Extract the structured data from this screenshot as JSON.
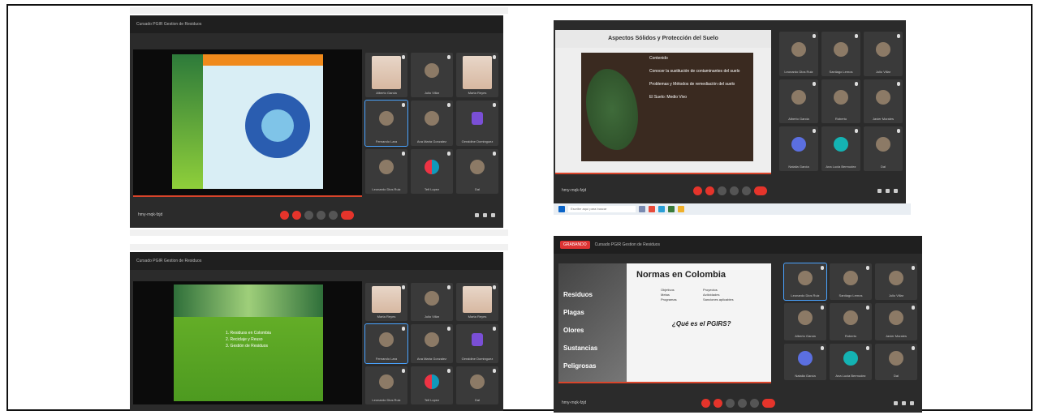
{
  "panels": {
    "tl": {
      "title": "Cursado PGIR Gestion de Residuos",
      "meeting_code": "hmy-rnqk-fzjd",
      "tiles": [
        {
          "name": "Alberto Garcia",
          "kind": "photo"
        },
        {
          "name": "Julio Villar",
          "kind": "avatar"
        },
        {
          "name": "Marta Reyes",
          "kind": "face"
        },
        {
          "name": "Fernando Lara",
          "kind": "avatar",
          "selected": true
        },
        {
          "name": "Ana Maria Gonzalez",
          "kind": "avatar"
        },
        {
          "name": "Geraldine Dominguez",
          "kind": "purple"
        },
        {
          "name": "Leonardo Dios Ruiz",
          "kind": "avatar"
        },
        {
          "name": "Tefi Lopez",
          "kind": "duo"
        },
        {
          "name": "Dal",
          "kind": "avatar"
        }
      ]
    },
    "tr": {
      "slide_title": "Aspectos Sólidos y Protección del Suelo",
      "slide_sub": "Contenido",
      "bullets": [
        "Conocer la sustitución de contaminantes del suelo",
        "Problemas y Métodos de remediación del suelo",
        "El Suelo: Medio Vivo"
      ],
      "meeting_code": "hmy-rnqk-fzjd",
      "taskbar_search": "Escribe aquí para buscar",
      "tiles": [
        {
          "name": "Leonardo Dios Ruiz",
          "kind": "avatar"
        },
        {
          "name": "Santiago Lemos",
          "kind": "avatar"
        },
        {
          "name": "Julio Villar",
          "kind": "avatar"
        },
        {
          "name": "Alberto Garcia",
          "kind": "avatar"
        },
        {
          "name": "Roberto",
          "kind": "avatar"
        },
        {
          "name": "Javier Morales",
          "kind": "avatar"
        },
        {
          "name": "Natalia Garcia",
          "kind": "blue"
        },
        {
          "name": "Ana Lucia Bermudez",
          "kind": "teal"
        },
        {
          "name": "Dal",
          "kind": "avatar"
        }
      ]
    },
    "bl": {
      "title": "Cursado PGIR Gestion de Residuos",
      "slide_items": [
        "1. Residuos en Colombia",
        "2. Reciclaje y Reuso",
        "3. Gestión de Residuos"
      ],
      "meeting_code": "hmy-rnqk-fzjd",
      "tiles": [
        {
          "name": "Marta Reyes",
          "kind": "face"
        },
        {
          "name": "Julio Villar",
          "kind": "avatar"
        },
        {
          "name": "Marta Reyes",
          "kind": "face"
        },
        {
          "name": "Fernando Lara",
          "kind": "avatar",
          "selected": true
        },
        {
          "name": "Ana Maria Gonzalez",
          "kind": "avatar"
        },
        {
          "name": "Geraldine Dominguez",
          "kind": "purple"
        },
        {
          "name": "Leonardo Dios Ruiz",
          "kind": "avatar"
        },
        {
          "name": "Tefi Lopez",
          "kind": "duo"
        },
        {
          "name": "Dal",
          "kind": "avatar"
        }
      ]
    },
    "br": {
      "rec_label": "GRABANDO",
      "title": "Cursado PGIR Gestion de Residuos",
      "slide_title": "Normas en Colombia",
      "left_bullets": [
        "Residuos",
        "Plagas",
        "Olores",
        "Sustancias Peligrosas"
      ],
      "col1": [
        "Objetivos",
        "Metas",
        "Programas"
      ],
      "col2": [
        "Proyectos",
        "Actividades",
        "Sanciones aplicables"
      ],
      "question": "¿Qué es el PGIRS?",
      "meeting_code": "hmy-rnqk-fzjd",
      "tiles": [
        {
          "name": "Leonardo Dios Ruiz",
          "kind": "avatar",
          "selected": true
        },
        {
          "name": "Santiago Lemos",
          "kind": "avatar"
        },
        {
          "name": "Julio Villar",
          "kind": "avatar"
        },
        {
          "name": "Alberto Garcia",
          "kind": "avatar"
        },
        {
          "name": "Roberto",
          "kind": "avatar"
        },
        {
          "name": "Javier Morales",
          "kind": "avatar"
        },
        {
          "name": "Natalia Garcia",
          "kind": "blue"
        },
        {
          "name": "Ana Lucia Bermudez",
          "kind": "teal"
        },
        {
          "name": "Dal",
          "kind": "avatar"
        }
      ]
    }
  }
}
